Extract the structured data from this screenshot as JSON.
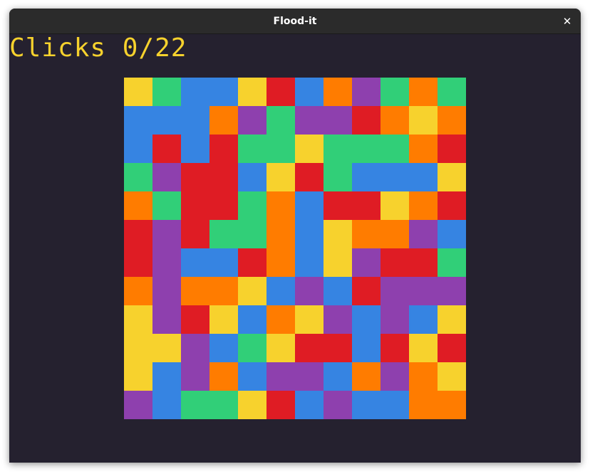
{
  "window": {
    "title": "Flood-it",
    "close_icon": "close-icon"
  },
  "game": {
    "clicks_text": "Clicks 0/22",
    "clicks": 0,
    "max_clicks": 22
  },
  "colors": {
    "Y": "#f7d22d",
    "G": "#31cf78",
    "B": "#3684e2",
    "R": "#df1c24",
    "O": "#ff7c00",
    "P": "#8e40ae",
    "background": "#25212f",
    "text": "#f7d22d"
  },
  "board": {
    "rows": 12,
    "cols": 12,
    "grid": [
      "YGBBYRBOPGOG",
      "BBBOPGPPROYO",
      "BRBRGGYGGGOR",
      "GPRRBYRGBBBY",
      "OGRRGOBRRYOR",
      "RPRGGOBYOOPB",
      "RPBBROBYPRRG",
      "OPOOYBPBRPPP",
      "YPRYBOYPBPBY",
      "YYPBGYRRBRYR",
      "YBPOBPPBOPOY",
      "PBGGYRBPBBOO"
    ]
  }
}
